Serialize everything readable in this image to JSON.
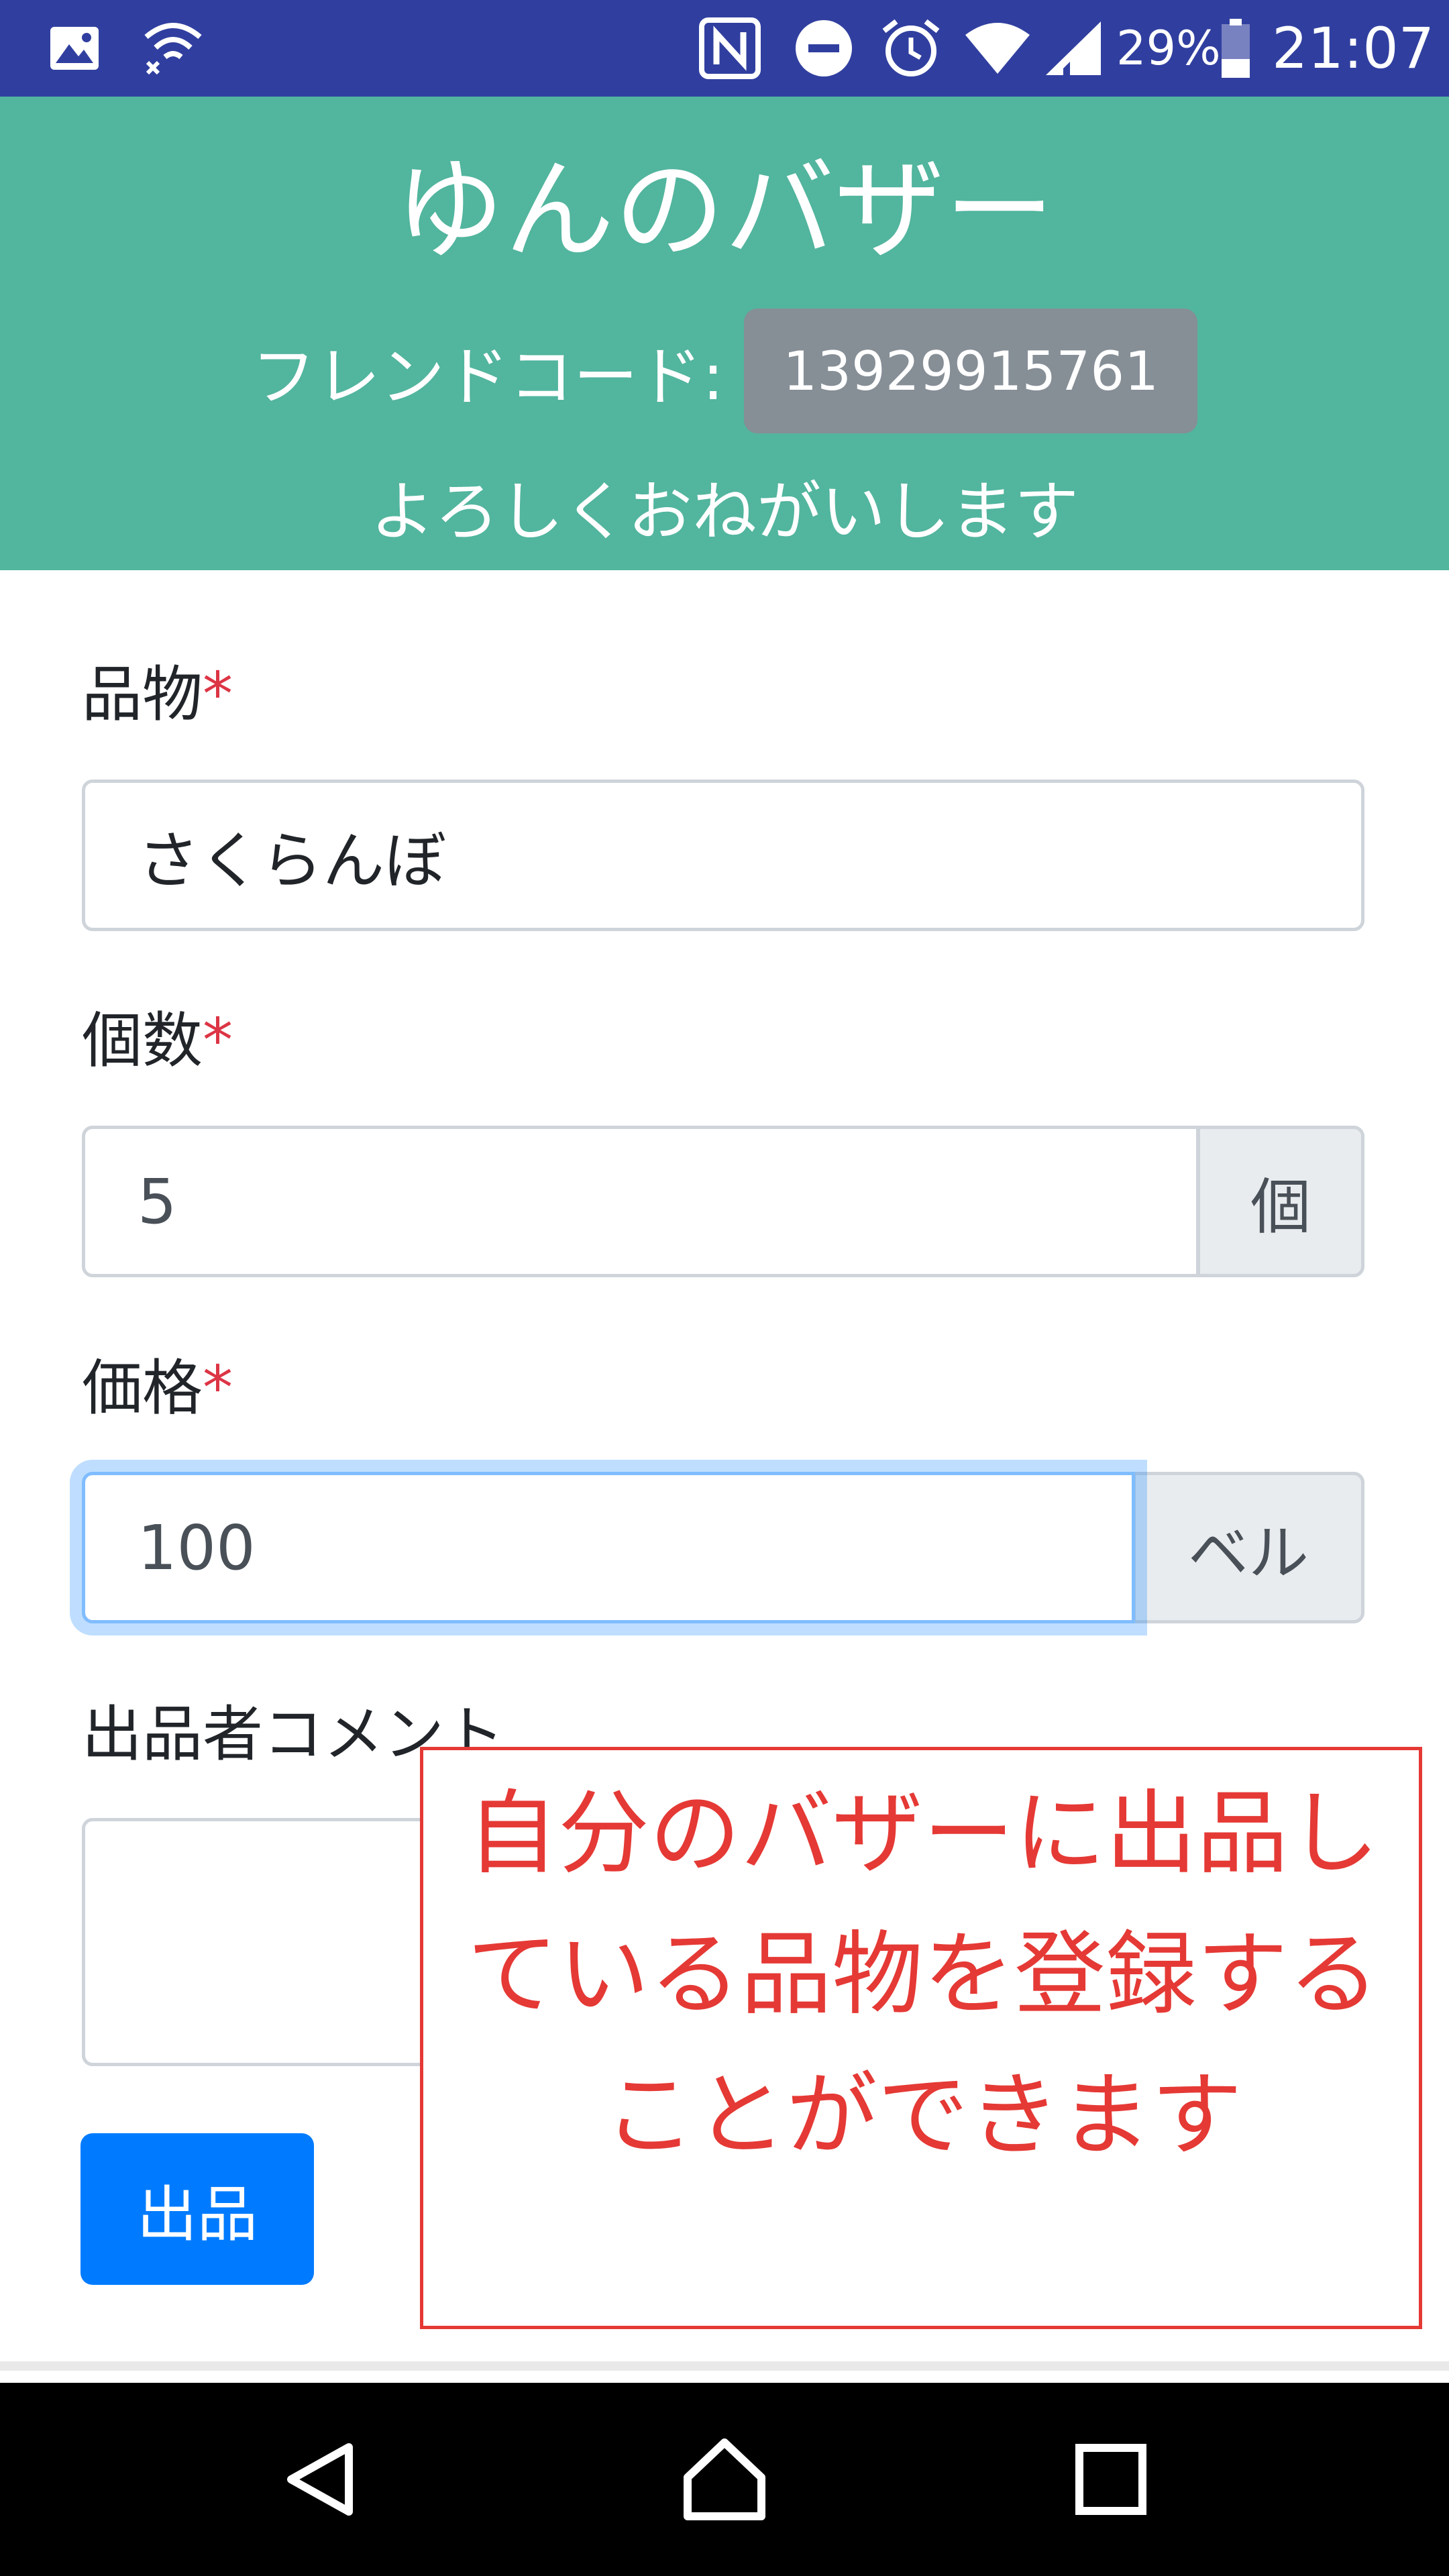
{
  "status_bar": {
    "battery": "29%",
    "time": "21:07"
  },
  "header": {
    "title": "ゆんのバザー",
    "friend_code_label": "フレンドコード:",
    "friend_code": "13929915761",
    "greeting": "よろしくおねがいします"
  },
  "form": {
    "item": {
      "label": "品物",
      "required": "*",
      "value": "さくらんぼ"
    },
    "quantity": {
      "label": "個数",
      "required": "*",
      "value": "5",
      "unit": "個"
    },
    "price": {
      "label": "価格",
      "required": "*",
      "value": "100",
      "unit": "ベル"
    },
    "comment": {
      "label": "出品者コメント",
      "value": ""
    },
    "submit_label": "出品"
  },
  "callout": {
    "text": "自分のバザーに出品している品物を登録することができます"
  },
  "colors": {
    "status_bar": "#303f9f",
    "header": "#52b59e",
    "primary": "#007bff",
    "required": "#dc3545",
    "callout": "#e53935"
  }
}
